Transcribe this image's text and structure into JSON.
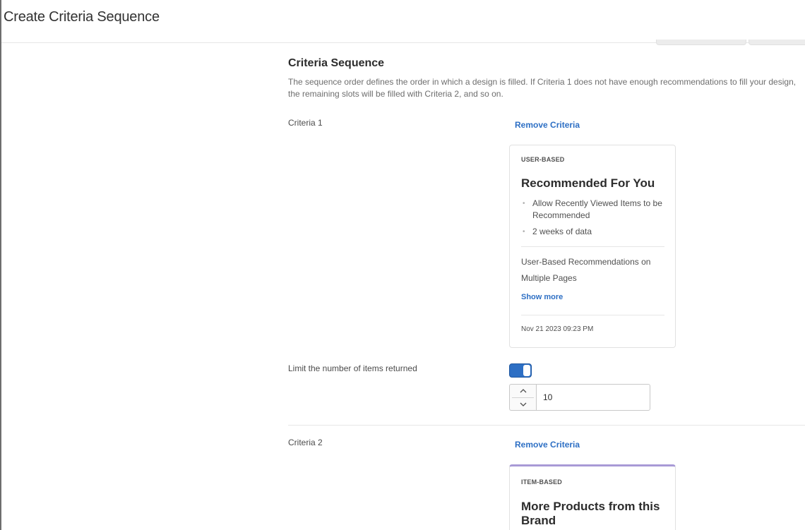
{
  "header": {
    "title": "Create Criteria Sequence"
  },
  "section": {
    "title": "Criteria Sequence",
    "description": "The sequence order defines the order in which a design is filled. If Criteria 1 does not have enough recommendations to fill your design, the remaining slots will be filled with Criteria 2, and so on."
  },
  "criteria": [
    {
      "label": "Criteria 1",
      "remove_label": "Remove Criteria",
      "card": {
        "type": "USER-BASED",
        "name": "Recommended For You",
        "bullets": [
          "Allow Recently Viewed Items to be Recommended",
          "2 weeks of data"
        ],
        "summary": "User-Based Recommendations on Multiple Pages",
        "show_more_label": "Show more",
        "date": "Nov 21 2023 09:23 PM"
      },
      "limit": {
        "label": "Limit the number of items returned",
        "enabled": true,
        "value": "10"
      }
    },
    {
      "label": "Criteria 2",
      "remove_label": "Remove Criteria",
      "card": {
        "type": "ITEM-BASED",
        "name": "More Products from this Brand"
      }
    }
  ],
  "icons": {
    "stepper_up": "chevron-up-icon",
    "stepper_down": "chevron-down-icon"
  },
  "colors": {
    "accent": "#2d6fc4",
    "item_based_accent": "#a89ad6"
  }
}
